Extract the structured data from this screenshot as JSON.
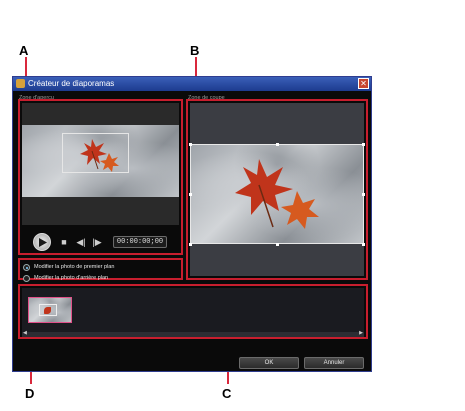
{
  "callouts": {
    "a": "A",
    "b": "B",
    "c": "C",
    "d": "D"
  },
  "window": {
    "title": "Créateur de diaporamas",
    "close_glyph": "✕"
  },
  "preview": {
    "label": "Zone d'aperçu",
    "timecode": "00:00:00;00",
    "controls": {
      "play": "▶",
      "stop": "■",
      "prev": "◀|",
      "next": "|▶"
    }
  },
  "crop": {
    "label": "Zone de coupe"
  },
  "options": {
    "foreground": "Modifier la photo de premier plan",
    "background": "Modifier la photo d'arrière plan",
    "selected": "foreground"
  },
  "timeline": {
    "scroll_left": "◀",
    "scroll_right": "▶"
  },
  "buttons": {
    "ok": "OK",
    "cancel": "Annuler"
  },
  "colors": {
    "callout_frame": "#c81e2e",
    "title_bar": "#1d3b8f",
    "leaf": "#c0341b"
  },
  "icons": [
    "app-icon",
    "close-icon",
    "play-icon",
    "stop-icon",
    "previous-frame-icon",
    "next-frame-icon",
    "leaf-icon"
  ]
}
